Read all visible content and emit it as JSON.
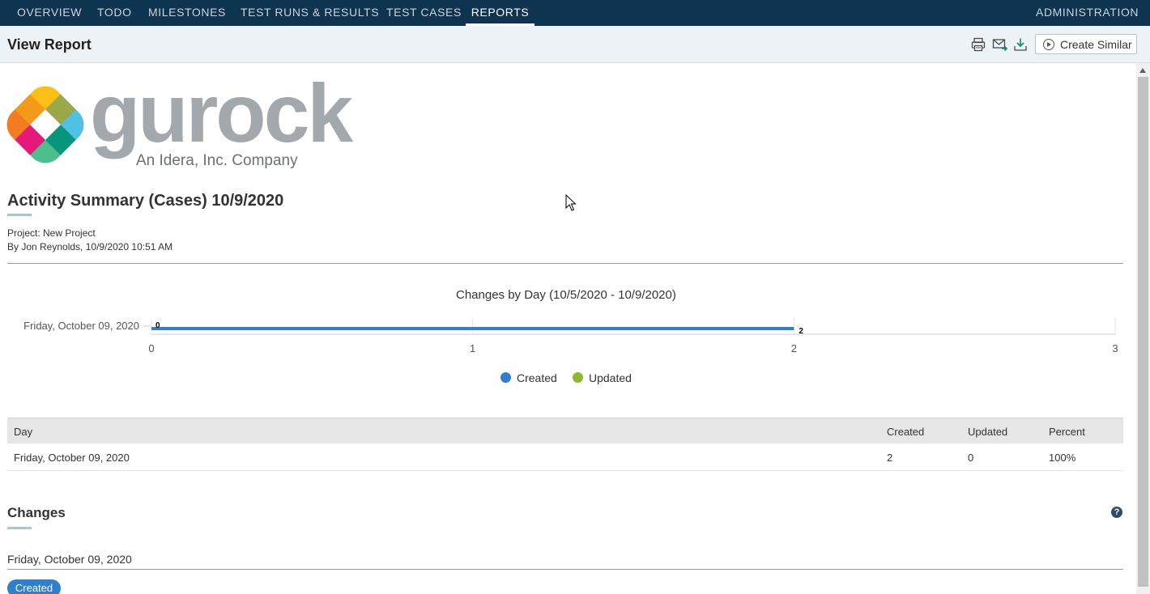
{
  "nav": {
    "tabs": [
      "Overview",
      "Todo",
      "Milestones",
      "Test Runs & Results",
      "Test Cases",
      "Reports"
    ],
    "active": "Reports",
    "admin": "Administration"
  },
  "header": {
    "title": "View Report",
    "create_similar": "Create Similar",
    "icons": [
      "print-icon",
      "email-icon",
      "download-icon"
    ]
  },
  "logo": {
    "word": "gurock",
    "tagline": "An Idera, Inc. Company",
    "colors": [
      "#f39a1b",
      "#fbbf16",
      "#9aa84a",
      "#4fc1e3",
      "#07967b",
      "#4cbf8c",
      "#702a86",
      "#e5197a",
      "#f47c20"
    ]
  },
  "report": {
    "title": "Activity Summary (Cases) 10/9/2020",
    "project": "Project: New Project",
    "byline": "By Jon Reynolds, 10/9/2020 10:51 AM"
  },
  "chart_data": {
    "type": "bar",
    "orientation": "horizontal",
    "title": "Changes by Day (10/5/2020 - 10/9/2020)",
    "categories": [
      "Friday, October 09, 2020"
    ],
    "series": [
      {
        "name": "Created",
        "color": "#2f7fce",
        "values": [
          2
        ]
      },
      {
        "name": "Updated",
        "color": "#8bb82c",
        "values": [
          0
        ]
      }
    ],
    "x_ticks": [
      "0",
      "1",
      "2",
      "3"
    ],
    "xlim": [
      0,
      3
    ],
    "data_labels": [
      "0",
      "2"
    ],
    "legend_position": "bottom"
  },
  "table": {
    "headers": [
      "Day",
      "Created",
      "Updated",
      "Percent"
    ],
    "rows": [
      [
        "Friday, October 09, 2020",
        "2",
        "0",
        "100%"
      ]
    ]
  },
  "changes": {
    "title": "Changes",
    "day": "Friday, October 09, 2020",
    "badge": "Created",
    "help": "?"
  }
}
